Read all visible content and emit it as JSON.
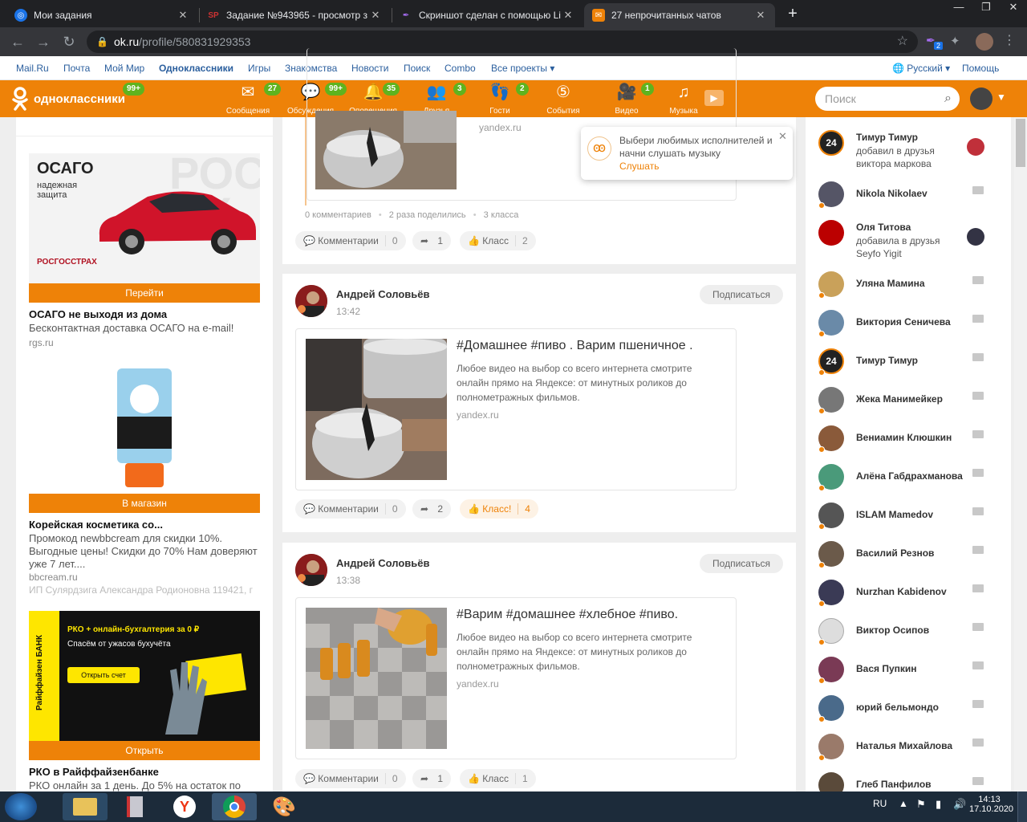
{
  "browser": {
    "tabs": [
      {
        "title": "Мои задания",
        "icon": "target-icon",
        "color": "#1a73e8",
        "active": false
      },
      {
        "title": "Задание №943965 - просмотр з",
        "icon": "sp-icon",
        "color": "#c33",
        "active": false
      },
      {
        "title": "Скриншот сделан с помощью Li",
        "icon": "feather-icon",
        "color": "#a56cf0",
        "active": false
      },
      {
        "title": "27 непрочитанных чатов",
        "icon": "mail-icon",
        "color": "#ee8208",
        "active": true
      }
    ],
    "url_host": "ok.ru",
    "url_path": "/profile/580831929353",
    "ext_badge": "2"
  },
  "portal": {
    "links": [
      "Mail.Ru",
      "Почта",
      "Мой Мир",
      "Одноклассники",
      "Игры",
      "Знакомства",
      "Новости",
      "Поиск",
      "Combo",
      "Все проекты ▾"
    ],
    "language": "Русский ▾",
    "help": "Помощь"
  },
  "header": {
    "logo_text": "одноклассники",
    "logo_badge": "99+",
    "nav": [
      {
        "label": "Сообщения",
        "badge": "27",
        "icon": "envelope-icon"
      },
      {
        "label": "Обсуждения",
        "badge": "99+",
        "icon": "chat-icon"
      },
      {
        "label": "Оповещения",
        "badge": "35",
        "icon": "bell-icon"
      },
      {
        "label": "Друзья",
        "badge": "3",
        "icon": "friends-icon"
      },
      {
        "label": "Гости",
        "badge": "2",
        "icon": "footprints-icon"
      },
      {
        "label": "События",
        "badge": "",
        "icon": "events-icon"
      },
      {
        "label": "Видео",
        "badge": "1",
        "icon": "video-camera-icon"
      },
      {
        "label": "Музыка",
        "badge": "",
        "icon": "music-note-icon"
      }
    ],
    "search_placeholder": "Поиск"
  },
  "left": {
    "ad1": {
      "img_title": "ОСАГО",
      "img_sub": "надежная защита",
      "brand": "РОСГОССТРАХ",
      "button": "Перейти",
      "title": "ОСАГО не выходя из дома",
      "text": "Бесконтактная доставка ОСАГО на e-mail!",
      "domain": "rgs.ru"
    },
    "ad2": {
      "button": "В магазин",
      "title": "Корейская косметика со...",
      "text": "Промокод newbbcream для скидки 10%. Выгодные цены! Скидки до 70% Нам доверяют уже 7 лет....",
      "domain": "bbcream.ru",
      "legal": "ИП Сулярдзига Александра Родионовна 119421, г"
    },
    "ad3": {
      "img_title": "РКО + онлайн-бухгалтерия за 0 ₽",
      "img_sub": "Спасём от ужасов бухучёта",
      "img_btn": "Открыть счет",
      "bank": "Райффайзен БАНК",
      "button": "Открыть",
      "title": "РКО в Райффайзенбанке",
      "text": "РКО онлайн за 1 день. До 5% на остаток по"
    }
  },
  "feed": {
    "post0": {
      "domain": "yandex.ru",
      "stats": [
        "0 комментариев",
        "2 раза поделились",
        "3 класса"
      ],
      "comments": "0",
      "shares": "1",
      "likes": "2"
    },
    "posts": [
      {
        "author": "Андрей Соловьёв",
        "time": "13:42",
        "subscribe": "Подписаться",
        "title": "#Домашнее #пиво . Варим пшеничное .",
        "desc": "Любое видео на выбор со всего интернета смотрите онлайн прямо на Яндексе: от минутных роликов до полнометражных фильмов.",
        "domain": "yandex.ru",
        "comment_label": "Комментарии",
        "comments": "0",
        "shares": "2",
        "like_label": "Класс!",
        "likes": "4"
      },
      {
        "author": "Андрей Соловьёв",
        "time": "13:38",
        "subscribe": "Подписаться",
        "title": "#Варим #домашнее #хлебное #пиво.",
        "desc": "Любое видео на выбор со всего интернета смотрите онлайн прямо на Яндексе: от минутных роликов до полнометражных фильмов.",
        "domain": "yandex.ru",
        "comment_label": "Комментарии",
        "comments": "0",
        "shares": "1",
        "like_label": "Класс",
        "likes": "1"
      }
    ],
    "comment_label": "Комментарии",
    "like_label": "Класс"
  },
  "popup": {
    "text": "Выбери любимых исполнителей и начни слушать музыку",
    "link": "Слушать"
  },
  "friends": [
    {
      "name": "Тимур Тимур",
      "sub": "добавил в друзья виктора маркова",
      "color": "#222"
    },
    {
      "name": "Nikola Nikolaev",
      "sub": "",
      "color": "#556"
    },
    {
      "name": "Оля Титова",
      "sub": "добавила в друзья Seyfo Yigit",
      "color": "#b00"
    },
    {
      "name": "Уляна Мамина",
      "sub": "",
      "color": "#c9a15a"
    },
    {
      "name": "Виктория Сеничева",
      "sub": "",
      "color": "#6a8aa8"
    },
    {
      "name": "Тимур Тимур",
      "sub": "",
      "color": "#222"
    },
    {
      "name": "Жека Манимейкер",
      "sub": "",
      "color": "#777"
    },
    {
      "name": "Вениамин Клюшкин",
      "sub": "",
      "color": "#8a5a3a"
    },
    {
      "name": "Алёна Габдрахманова",
      "sub": "",
      "color": "#4a9a7a"
    },
    {
      "name": "ISLAM Mamedov",
      "sub": "",
      "color": "#555"
    },
    {
      "name": "Василий Резнов",
      "sub": "",
      "color": "#6b5a4a"
    },
    {
      "name": "Nurzhan Kabidenov",
      "sub": "",
      "color": "#3a3a55"
    },
    {
      "name": "Виктор Осипов",
      "sub": "",
      "color": "#ddd"
    },
    {
      "name": "Вася Пупкин",
      "sub": "",
      "color": "#7a3a55"
    },
    {
      "name": "юрий бельмондо",
      "sub": "",
      "color": "#4a6a8a"
    },
    {
      "name": "Наталья Михайлова",
      "sub": "",
      "color": "#9a7a6a"
    },
    {
      "name": "Глеб Панфилов",
      "sub": "",
      "color": "#5a4a3a"
    }
  ],
  "taskbar": {
    "lang": "RU",
    "time": "14:13",
    "date": "17.10.2020"
  }
}
